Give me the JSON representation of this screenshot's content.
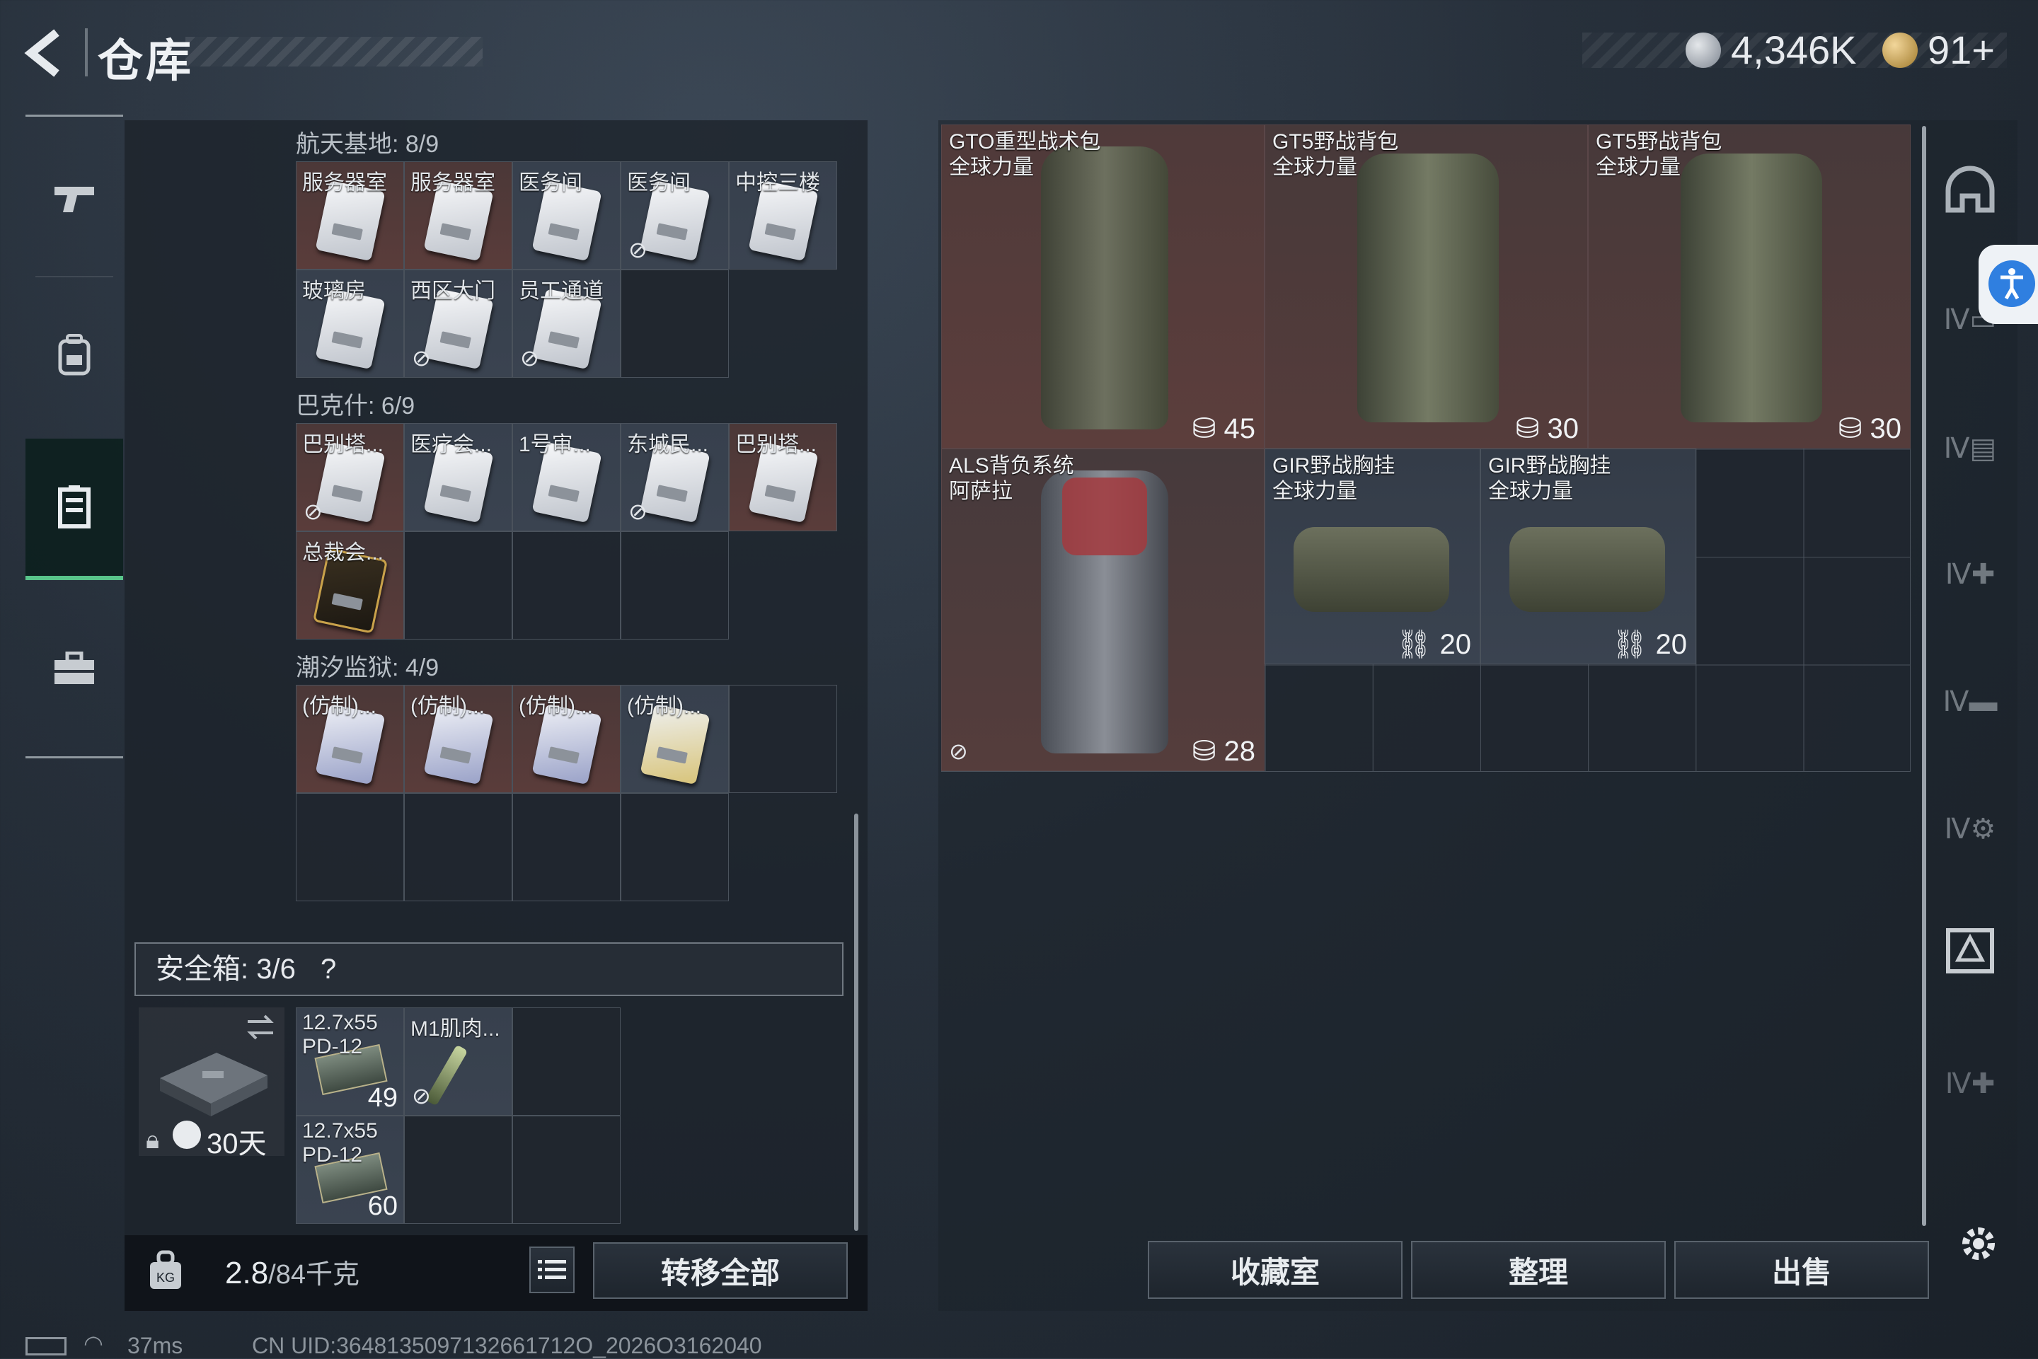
{
  "header": {
    "title": "仓库",
    "currency_silver": "4,346K",
    "currency_gold": "91+",
    "silver_icon": "silver-coin-icon",
    "gold_icon": "gold-coin-icon"
  },
  "nav": {
    "items": [
      {
        "name": "weapons",
        "icon": "pistol-icon"
      },
      {
        "name": "backpack",
        "icon": "backpack-icon"
      },
      {
        "name": "storage",
        "icon": "locker-icon",
        "active": true
      },
      {
        "name": "toolbox",
        "icon": "briefcase-icon"
      }
    ]
  },
  "keys": {
    "sections": [
      {
        "title": "航天基地: 8/9",
        "items": [
          "服务器室",
          "服务器室",
          "医务间",
          "医务间",
          "中控三楼",
          "玻璃房",
          "西区大门",
          "员工通道"
        ]
      },
      {
        "title": "巴克什: 6/9",
        "items": [
          "巴别塔...",
          "医疗会...",
          "1号审...",
          "东城民...",
          "巴别塔...",
          "总裁会..."
        ]
      },
      {
        "title": "潮汐监狱: 4/9",
        "items": [
          "(仿制)...",
          "(仿制)...",
          "(仿制)...",
          "(仿制)..."
        ]
      }
    ]
  },
  "safebox": {
    "title": "安全箱: 3/6",
    "help": "?",
    "duration": "30天",
    "items": [
      {
        "label": "12.7x55 PD-12",
        "qty": "49"
      },
      {
        "label": "M1肌肉...",
        "qty": ""
      },
      {
        "label": "12.7x55 PD-12",
        "qty": "60"
      }
    ]
  },
  "footer_left": {
    "weight": "2.8",
    "capacity": "/84千克",
    "transfer_all": "转移全部"
  },
  "equipment": {
    "items": [
      {
        "name": "GTO重型战术包",
        "sub": "全球力量",
        "capacity": "45"
      },
      {
        "name": "GT5野战背包",
        "sub": "全球力量",
        "capacity": "30"
      },
      {
        "name": "GT5野战背包",
        "sub": "全球力量",
        "capacity": "30"
      },
      {
        "name": "ALS背负系统",
        "sub": "阿萨拉",
        "capacity": "28"
      },
      {
        "name": "GIR野战胸挂",
        "sub": "全球力量",
        "capacity": "20"
      },
      {
        "name": "GIR野战胸挂",
        "sub": "全球力量",
        "capacity": "20"
      }
    ]
  },
  "footer_right": {
    "collection": "收藏室",
    "organize": "整理",
    "sell": "出售"
  },
  "status": {
    "ping": "37ms",
    "uid": "CN UID:3648135097132661712O_2026O3162040"
  },
  "colors": {
    "accent_green": "#59c48a",
    "item_bg_red": "#5a3c3a",
    "accessibility_blue": "#2f7fe0"
  }
}
